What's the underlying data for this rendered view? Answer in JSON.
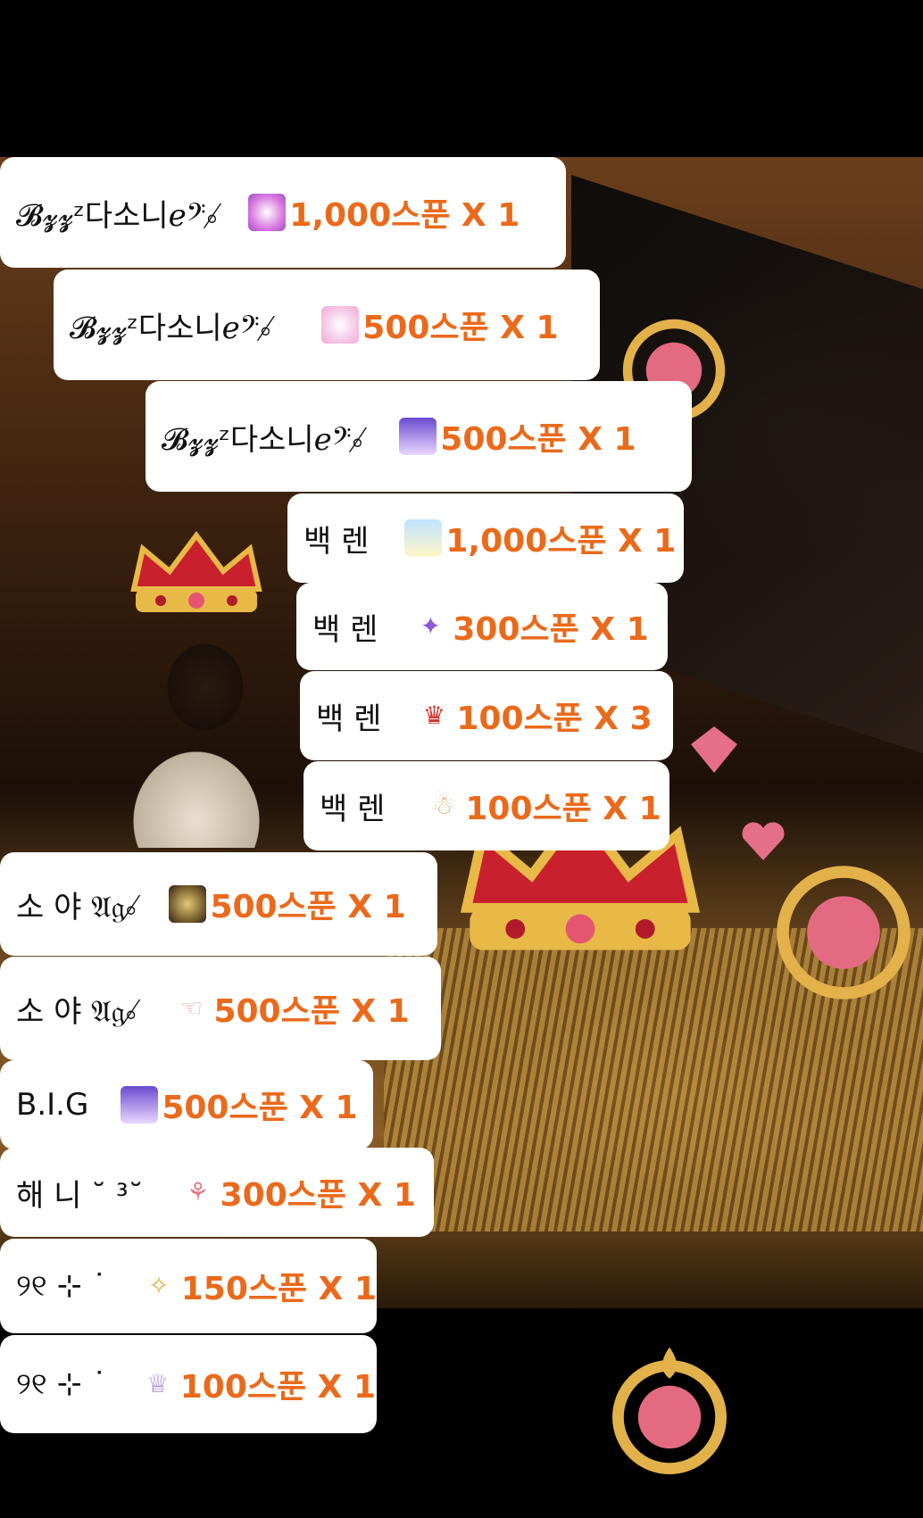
{
  "gifts": [
    {
      "name": "𝓑𝔃𝔃ᶻ다소니ℯ𝄢⸰̸",
      "icon": "sparkle-gift-icon",
      "amount": "1,000스푼 X 1"
    },
    {
      "name": "𝓑𝔃𝔃ᶻ다소니ℯ𝄢⸰̸",
      "icon": "petal-gift-icon",
      "amount": "500스푼 X 1"
    },
    {
      "name": "𝓑𝔃𝔃ᶻ다소니ℯ𝄢⸰̸",
      "icon": "purple-sparkle-gift-icon",
      "amount": "500스푼 X 1"
    },
    {
      "name": "백 렌",
      "icon": "sky-gift-icon",
      "amount": "1,000스푼 X 1"
    },
    {
      "name": "백 렌",
      "icon": "wand-gift-icon",
      "amount": "300스푼 X 1"
    },
    {
      "name": "백 렌",
      "icon": "crown-gift-icon",
      "amount": "100스푼 X 3"
    },
    {
      "name": "백 렌",
      "icon": "figure-gift-icon",
      "amount": "100스푼 X 1"
    },
    {
      "name": "소 야 𝔄𝔤⸰̸",
      "icon": "pan-gift-icon",
      "amount": "500스푼 X 1"
    },
    {
      "name": "소 야 𝔄𝔤⸰̸",
      "icon": "hand-gift-icon",
      "amount": "500스푼 X 1"
    },
    {
      "name": "B.I.G",
      "icon": "purple-sparkle-gift-icon",
      "amount": "500스푼 X 1"
    },
    {
      "name": "해 니 ˘ ³˘",
      "icon": "bicycle-gift-icon",
      "amount": "300스푼 X 1"
    },
    {
      "name": "୨୧ ⊹ ˙",
      "icon": "confetti-gift-icon",
      "amount": "150스푼 X 1"
    },
    {
      "name": "୨୧ ⊹ ˙",
      "icon": "tiara-gift-icon",
      "amount": "100스푼 X 1"
    }
  ],
  "colors": {
    "amount": "#ea6a1b",
    "name": "#111111",
    "row_background": "#ffffff"
  }
}
